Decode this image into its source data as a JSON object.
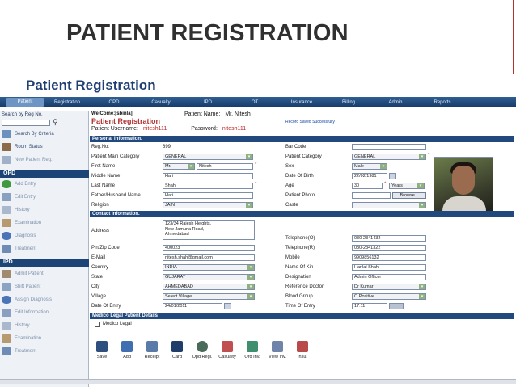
{
  "slide": {
    "title": "PATIENT REGISTRATION"
  },
  "app": {
    "title": "Patient Registration"
  },
  "nav": [
    "Patient",
    "Registration",
    "OPD",
    "Casualty",
    "IPD",
    "OT",
    "Insurance",
    "Billing",
    "Admin",
    "Reports"
  ],
  "sidebar": {
    "search_label": "Search by Reg No.",
    "items_top": [
      "Search By Criteria",
      "Room Status",
      "New Patient Reg."
    ],
    "opd_head": "OPD",
    "opd_items": [
      "Add Entry",
      "Edit Entry",
      "History",
      "Examination",
      "Diagnosis",
      "Treatment"
    ],
    "ipd_head": "IPD",
    "ipd_items": [
      "Admit Patient",
      "Shift Patient",
      "Assign Diagnosis",
      "Edit Information",
      "History",
      "Examination",
      "Treatment"
    ]
  },
  "header": {
    "welcome": "WelCome:[sbinla]",
    "patient_name_label": "Patient Name:",
    "patient_name": "Mr. Nitesh",
    "section_title": "Patient Registration",
    "saved_msg": "Record Saved Successfully",
    "username_label": "Patient Username:",
    "username": "nitesh111",
    "password_label": "Password:",
    "password": "nitesh111"
  },
  "personal": {
    "title": "Personal Information.",
    "reg_no_label": "Reg.No:",
    "reg_no": "899",
    "main_category_label": "Patient Main Category",
    "main_category": "GENERAL",
    "first_name_label": "First Name",
    "salutation": "Mr.",
    "first_name": "Nitesh",
    "middle_name_label": "Middle Name",
    "middle_name": "Hari",
    "last_name_label": "Last Name",
    "last_name": "Shah",
    "father_label": "Father/Husband Name",
    "father": "Hari",
    "religion_label": "Religion",
    "religion": "JAIN",
    "barcode_label": "Bar Code",
    "category_label": "Patient Category",
    "category": "GENERAL",
    "sex_label": "Sex",
    "sex": "Male",
    "dob_label": "Date Of Birth",
    "dob": "22/02/1981",
    "age_label": "Age",
    "age": "30",
    "age_unit": "Years",
    "photo_label": "Patient Photo",
    "browse": "Browse...",
    "caste_label": "Caste"
  },
  "contact": {
    "title": "Contact Information.",
    "address_label": "Address",
    "address_lines": [
      "123/34 Rajesh Heights,",
      "New Jamuna Road,",
      "Ahmedabad"
    ],
    "pin_label": "Pin/Zip Code",
    "pin": "400023",
    "email_label": "E-Mail",
    "email": "nitesh.shah@gmail.com",
    "country_label": "Country",
    "country": "INDIA",
    "state_label": "State",
    "state": "GUJARAT",
    "city_label": "City",
    "city": "AHMEDABAD",
    "village_label": "Village",
    "village": "Select Village",
    "doe_label": "Date Of Entry",
    "doe": "24/01/2011",
    "tel_o_label": "Telephone(O)",
    "tel_o": "030-2341432",
    "tel_r_label": "Telephone(R)",
    "tel_r": "030-2341322",
    "mobile_label": "Mobile",
    "mobile": "9909856132",
    "kin_label": "Name Of Kin",
    "kin": "Harilal Shah",
    "designation_label": "Designation",
    "designation": "Admin Officer",
    "ref_doc_label": "Reference Doctor",
    "ref_doc": "Dr Kumar",
    "blood_label": "Blood Group",
    "blood": "O Positive",
    "toe_label": "Time Of Entry",
    "toe": "17:11"
  },
  "medico": {
    "title": "Medico Legal Patient Details",
    "checkbox_label": "Medico Legal"
  },
  "toolbar": [
    "Save",
    "Add",
    "Receipt",
    "Card",
    "Opd Regi.",
    "Casualty",
    "Ord Inv.",
    "View Inv.",
    "Insu."
  ],
  "colors": {
    "nav": "#1d4477",
    "accent_red": "#b03030",
    "section": "#22497d"
  }
}
